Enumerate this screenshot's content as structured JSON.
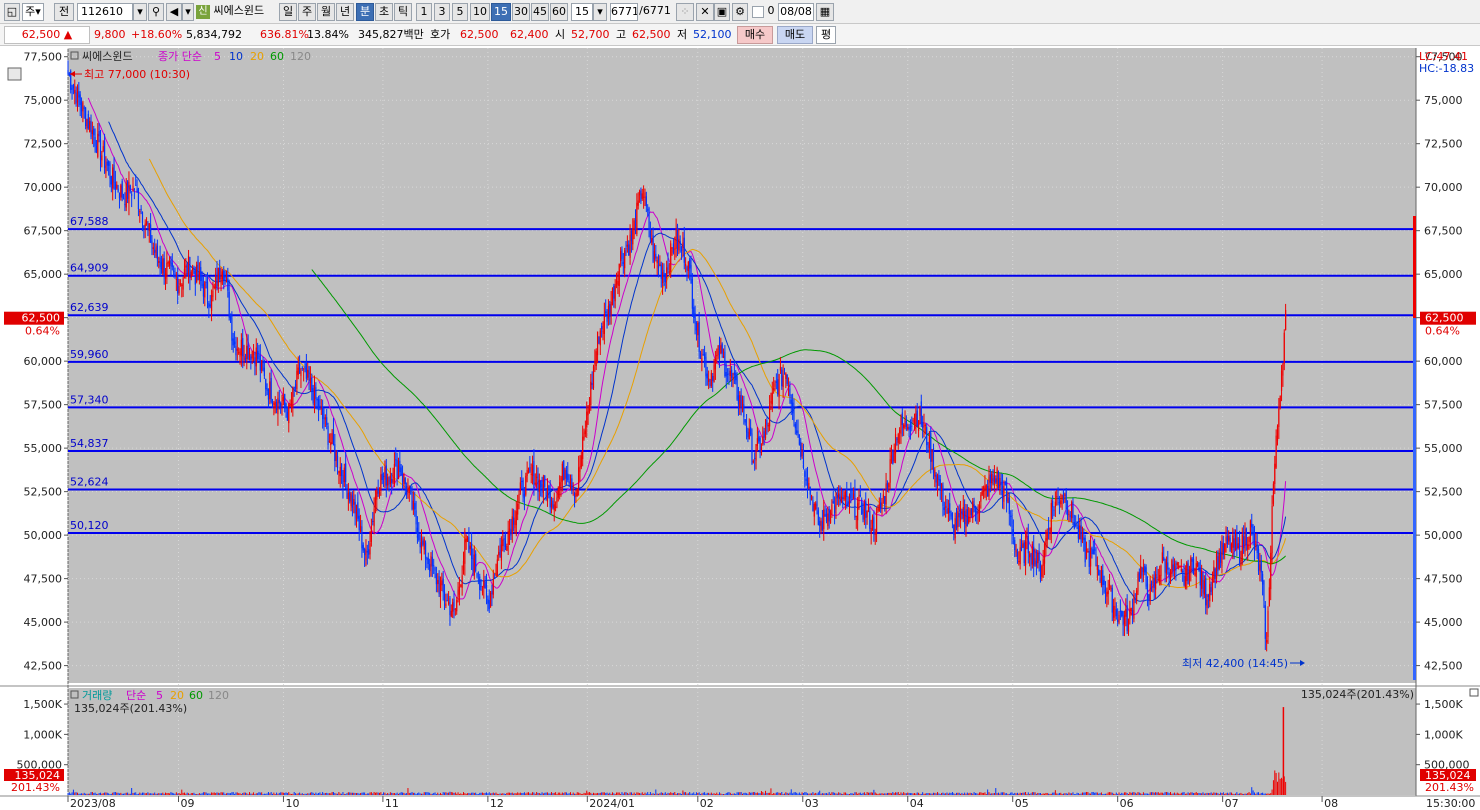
{
  "toolbar": {
    "buttons": [
      "주",
      "전"
    ],
    "code": "112610",
    "search_icon": "search-icon",
    "sound_icon": "speaker-icon",
    "badge": "신",
    "name": "씨에스윈드",
    "periods": [
      "일",
      "주",
      "월",
      "년",
      "분",
      "초",
      "틱"
    ],
    "active_period": "분",
    "intervals": [
      "1",
      "3",
      "5",
      "10",
      "15",
      "30",
      "45",
      "60"
    ],
    "active_interval": "15",
    "interval_select": "15",
    "count_current": "6771",
    "count_total": "/6771",
    "checkbox_label": "0",
    "date": "08/08"
  },
  "quote": {
    "price": "62,500",
    "arrow": "▲",
    "change": "9,800",
    "change_pct": "+18.60%",
    "volume": "5,834,792",
    "volume_ratio": "636.81%",
    "turnover": "13.84%",
    "amount": "345,827백만",
    "bid_label": "호가",
    "ask": "62,500",
    "bid": "62,400",
    "open_label": "시",
    "open": "52,700",
    "high_label": "고",
    "high": "62,500",
    "low_label": "저",
    "low": "52,100",
    "buy_button": "매수",
    "sell_button": "매도",
    "avg_button": "평"
  },
  "chart": {
    "legend_name": "씨에스윈드",
    "legend_type": "종가 단순",
    "ma_periods": [
      "5",
      "10",
      "20",
      "60",
      "120"
    ],
    "ma_colors": [
      "#cc00cc",
      "#0033cc",
      "#e8a000",
      "#009900",
      "#888888"
    ],
    "max_label": "최고 77,000 (10:30)",
    "min_label": "최저 42,400 (14:45)",
    "lc_label": "LC:47.41",
    "hc_label": "HC:-18.83",
    "current_price_tag": "62,500",
    "current_pct_tag": "0.64%",
    "vol_legend_name": "거래량",
    "vol_legend_type": "단순",
    "vol_ma_periods": [
      "5",
      "20",
      "60",
      "120"
    ],
    "vol_summary": "135,024주(201.43%)",
    "vol_current_tag": "135,024",
    "vol_pct_tag": "201.43%",
    "time_label": "15:30:00",
    "colors": {
      "up": "#ee0000",
      "down": "#0033ff",
      "hline": "#0000ee",
      "bg": "#c0c0c0"
    }
  },
  "chart_data": {
    "type": "candlestick",
    "title": "씨에스윈드",
    "y_ticks": [
      "77,500",
      "75,000",
      "72,500",
      "70,000",
      "67,500",
      "65,000",
      "62,500",
      "60,000",
      "57,500",
      "55,000",
      "52,500",
      "50,000",
      "47,500",
      "45,000",
      "42,500"
    ],
    "ylim": [
      41500,
      78000
    ],
    "x_labels": [
      "2023/08",
      "09",
      "10",
      "11",
      "12",
      "2024/01",
      "02",
      "03",
      "04",
      "05",
      "06",
      "07",
      "08"
    ],
    "horizontal_lines": [
      {
        "label": "67,588",
        "value": 67588
      },
      {
        "label": "64,909",
        "value": 64909
      },
      {
        "label": "62,639",
        "value": 62639
      },
      {
        "label": "59,960",
        "value": 59960
      },
      {
        "label": "57,340",
        "value": 57340
      },
      {
        "label": "54,837",
        "value": 54837
      },
      {
        "label": "52,624",
        "value": 52624
      },
      {
        "label": "50,120",
        "value": 50120
      }
    ],
    "price_path": [
      [
        0,
        76500
      ],
      [
        2,
        73500
      ],
      [
        4,
        70500
      ],
      [
        5,
        69500
      ],
      [
        6,
        70000
      ],
      [
        8,
        66000
      ],
      [
        10,
        64500
      ],
      [
        11,
        65500
      ],
      [
        13,
        63500
      ],
      [
        14,
        65800
      ],
      [
        15,
        61000
      ],
      [
        17,
        60500
      ],
      [
        18,
        58500
      ],
      [
        20,
        57000
      ],
      [
        21,
        59500
      ],
      [
        22,
        58500
      ],
      [
        24,
        55000
      ],
      [
        26,
        51500
      ],
      [
        27,
        48500
      ],
      [
        28,
        53000
      ],
      [
        30,
        54000
      ],
      [
        31,
        52000
      ],
      [
        32,
        49500
      ],
      [
        34,
        46500
      ],
      [
        35,
        45500
      ],
      [
        36,
        49500
      ],
      [
        37,
        48000
      ],
      [
        38,
        46000
      ],
      [
        39,
        49000
      ],
      [
        40,
        50500
      ],
      [
        41,
        52500
      ],
      [
        42,
        53500
      ],
      [
        44,
        52000
      ],
      [
        45,
        54000
      ],
      [
        46,
        52500
      ],
      [
        47,
        57000
      ],
      [
        48,
        61500
      ],
      [
        49,
        63000
      ],
      [
        50,
        66000
      ],
      [
        51,
        67000
      ],
      [
        52,
        70000
      ],
      [
        53,
        66000
      ],
      [
        54,
        65000
      ],
      [
        55,
        67000
      ],
      [
        56,
        66000
      ],
      [
        57,
        61500
      ],
      [
        58,
        59000
      ],
      [
        59,
        60500
      ],
      [
        60,
        59000
      ],
      [
        61,
        57500
      ],
      [
        62,
        54500
      ],
      [
        63,
        55500
      ],
      [
        64,
        58500
      ],
      [
        65,
        59500
      ],
      [
        66,
        56000
      ],
      [
        67,
        53000
      ],
      [
        68,
        50500
      ],
      [
        69,
        51500
      ],
      [
        70,
        52000
      ],
      [
        72,
        51500
      ],
      [
        73,
        50500
      ],
      [
        74,
        52500
      ],
      [
        75,
        56000
      ],
      [
        76,
        56500
      ],
      [
        77,
        57000
      ],
      [
        78,
        55000
      ],
      [
        79,
        52500
      ],
      [
        80,
        50500
      ],
      [
        81,
        51000
      ],
      [
        82,
        51500
      ],
      [
        83,
        52500
      ],
      [
        84,
        53500
      ],
      [
        85,
        52000
      ],
      [
        86,
        48500
      ],
      [
        87,
        49500
      ],
      [
        88,
        48000
      ],
      [
        89,
        51500
      ],
      [
        90,
        52500
      ],
      [
        91,
        51000
      ],
      [
        92,
        49000
      ],
      [
        93,
        48500
      ],
      [
        94,
        47000
      ],
      [
        95,
        45500
      ],
      [
        96,
        45000
      ],
      [
        97,
        48000
      ],
      [
        98,
        46500
      ],
      [
        99,
        48500
      ],
      [
        100,
        48000
      ],
      [
        101,
        47500
      ],
      [
        102,
        48500
      ],
      [
        103,
        46500
      ],
      [
        104,
        48500
      ],
      [
        105,
        49500
      ],
      [
        106,
        49000
      ],
      [
        107,
        50500
      ],
      [
        108,
        47500
      ],
      [
        108.5,
        43500
      ],
      [
        109,
        52000
      ],
      [
        109.7,
        58500
      ],
      [
        110.2,
        62500
      ]
    ],
    "max": {
      "value": 77000,
      "time": "10:30"
    },
    "min": {
      "value": 42400,
      "time": "14:45"
    },
    "last": 62500,
    "volume": {
      "y_ticks": [
        "1,500K",
        "1,000K",
        "500,000"
      ],
      "ylim": [
        0,
        1600000
      ],
      "last": 135024,
      "last_pct": "201.43%"
    }
  }
}
